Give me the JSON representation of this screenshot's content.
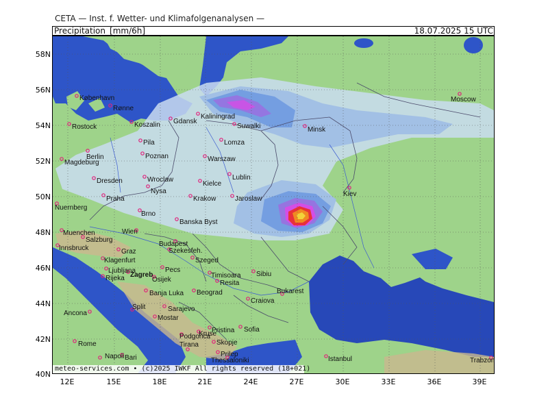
{
  "header": {
    "title": "CETA — Inst. f. Wetter- und Klimafolgenanalysen —",
    "left": "Precipitation_[mm/6h]",
    "right": "18.07.2025 15 UTC"
  },
  "axes": {
    "lat_labels": [
      "58N",
      "56N",
      "54N",
      "52N",
      "50N",
      "48N",
      "46N",
      "44N",
      "42N",
      "40N"
    ],
    "lon_labels": [
      "12E",
      "15E",
      "18E",
      "21E",
      "24E",
      "27E",
      "30E",
      "33E",
      "36E",
      "39E"
    ]
  },
  "cities": [
    {
      "name": "København"
    },
    {
      "name": "Rønne"
    },
    {
      "name": "Rostock"
    },
    {
      "name": "Koszalin"
    },
    {
      "name": "Gdansk"
    },
    {
      "name": "Kaliningrad"
    },
    {
      "name": "Suwalki"
    },
    {
      "name": "Minsk"
    },
    {
      "name": "Moscow"
    },
    {
      "name": "Pila"
    },
    {
      "name": "Lomza"
    },
    {
      "name": "Berlin"
    },
    {
      "name": "Poznan"
    },
    {
      "name": "Warszaw"
    },
    {
      "name": "Magdeburg"
    },
    {
      "name": "Lublin"
    },
    {
      "name": "Dresden"
    },
    {
      "name": "Wroclaw"
    },
    {
      "name": "Kielce"
    },
    {
      "name": "Nysa"
    },
    {
      "name": "Praha"
    },
    {
      "name": "Krakow"
    },
    {
      "name": "Jaroslaw"
    },
    {
      "name": "Kiev"
    },
    {
      "name": "Nuernberg"
    },
    {
      "name": "Brno"
    },
    {
      "name": "Banska Byst"
    },
    {
      "name": "Muenchen"
    },
    {
      "name": "Wien"
    },
    {
      "name": "Salzburg"
    },
    {
      "name": "Budapest"
    },
    {
      "name": "Innsbruck"
    },
    {
      "name": "Szekesfeh."
    },
    {
      "name": "Graz"
    },
    {
      "name": "Szeged"
    },
    {
      "name": "Klagenfurt"
    },
    {
      "name": "Ljubljana"
    },
    {
      "name": "Pecs"
    },
    {
      "name": "Zagreb"
    },
    {
      "name": "Rijeka"
    },
    {
      "name": "Osijek"
    },
    {
      "name": "Timisoara"
    },
    {
      "name": "Sibiu"
    },
    {
      "name": "Resita"
    },
    {
      "name": "Banja Luka"
    },
    {
      "name": "Beograd"
    },
    {
      "name": "Bukarest"
    },
    {
      "name": "Craiova"
    },
    {
      "name": "Split"
    },
    {
      "name": "Sarajevo"
    },
    {
      "name": "Ancona"
    },
    {
      "name": "Mostar"
    },
    {
      "name": "Sofia"
    },
    {
      "name": "Pristina"
    },
    {
      "name": "Kruse"
    },
    {
      "name": "Podgorica"
    },
    {
      "name": "Tirana"
    },
    {
      "name": "Skopje"
    },
    {
      "name": "Rome"
    },
    {
      "name": "Prilep"
    },
    {
      "name": "Napoli"
    },
    {
      "name": "Bari"
    },
    {
      "name": "Thessaloniki"
    },
    {
      "name": "Istanbul"
    },
    {
      "name": "Trabzon"
    }
  ],
  "footer": "meteo-services.com • (c)2025 IWKF All rights reserved (18+021)",
  "colors": {
    "land": "#9ed38a",
    "sea": "#2e55c8",
    "sea_dark": "#2748b8",
    "rain_light": "#c9dcf0",
    "rain_med": "#9fbde6",
    "rain_blue": "#6f9ae0",
    "rain_purple": "#9a6fe0",
    "rain_magenta": "#d44ee6",
    "rain_red": "#e8313a",
    "rain_orange": "#f08a22",
    "rain_yellow": "#f2d33a",
    "mountain": "#c9b88e",
    "city_marker": "#e0207a"
  }
}
